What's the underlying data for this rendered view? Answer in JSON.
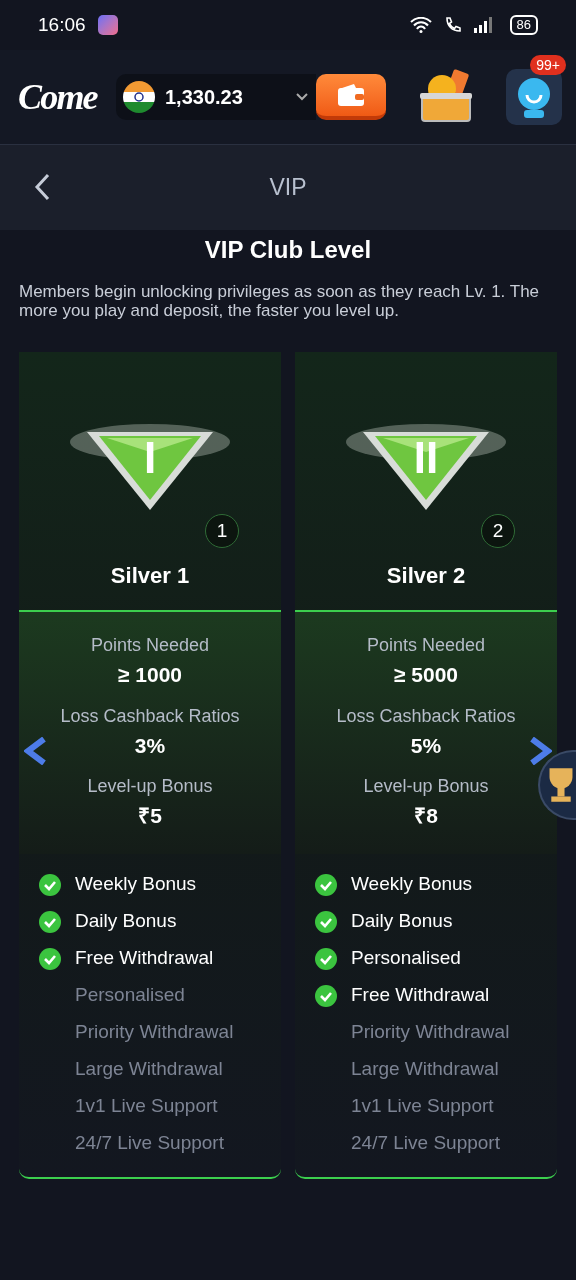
{
  "status_bar": {
    "time": "16:06",
    "battery": "86"
  },
  "header": {
    "logo": "Come",
    "balance": "1,330.23",
    "notification_badge": "99+"
  },
  "nav": {
    "title": "VIP"
  },
  "title": "VIP Club Level",
  "description": "Members begin unlocking privileges as soon as they reach Lv. 1. The more you play and deposit, the faster you level up.",
  "levels": [
    {
      "numeral": "I",
      "level_number": "1",
      "name": "Silver 1",
      "stats": [
        {
          "label": "Points Needed",
          "value": "≥ 1000"
        },
        {
          "label": "Loss Cashback Ratios",
          "value": "3%"
        },
        {
          "label": "Level-up Bonus",
          "value": "₹5"
        }
      ],
      "perks": [
        {
          "label": "Weekly Bonus",
          "unlocked": true
        },
        {
          "label": "Daily Bonus",
          "unlocked": true
        },
        {
          "label": "Free Withdrawal",
          "unlocked": true
        },
        {
          "label": "Personalised",
          "unlocked": false
        },
        {
          "label": "Priority Withdrawal",
          "unlocked": false
        },
        {
          "label": "Large Withdrawal",
          "unlocked": false
        },
        {
          "label": "1v1 Live Support",
          "unlocked": false
        },
        {
          "label": "24/7 Live Support",
          "unlocked": false
        }
      ]
    },
    {
      "numeral": "II",
      "level_number": "2",
      "name": "Silver 2",
      "stats": [
        {
          "label": "Points Needed",
          "value": "≥ 5000"
        },
        {
          "label": "Loss Cashback Ratios",
          "value": "5%"
        },
        {
          "label": "Level-up Bonus",
          "value": "₹8"
        }
      ],
      "perks": [
        {
          "label": "Weekly Bonus",
          "unlocked": true
        },
        {
          "label": "Daily Bonus",
          "unlocked": true
        },
        {
          "label": "Personalised",
          "unlocked": true
        },
        {
          "label": "Free Withdrawal",
          "unlocked": true
        },
        {
          "label": "Priority Withdrawal",
          "unlocked": false
        },
        {
          "label": "Large Withdrawal",
          "unlocked": false
        },
        {
          "label": "1v1 Live Support",
          "unlocked": false
        },
        {
          "label": "24/7 Live Support",
          "unlocked": false
        }
      ]
    }
  ]
}
